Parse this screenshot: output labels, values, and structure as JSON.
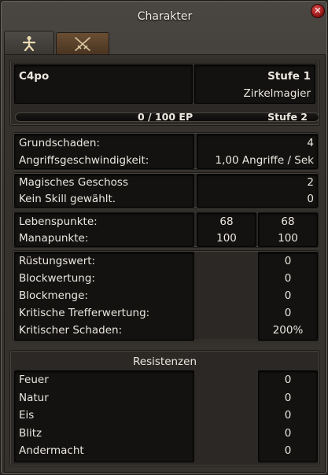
{
  "window": {
    "title": "Charakter"
  },
  "tabs": [
    {
      "name": "character",
      "icon": "person-icon",
      "active": true
    },
    {
      "name": "skills",
      "icon": "crossed-swords-icon",
      "active": false
    }
  ],
  "header": {
    "name": "C4po",
    "level_label": "Stufe 1",
    "class_name": "Zirkelmagier",
    "xp_text": "0 / 100 EP",
    "next_level": "Stufe 2",
    "xp_progress": 0
  },
  "damage": {
    "base_damage_label": "Grundschaden:",
    "base_damage_value": "4",
    "attack_speed_label": "Angriffsgeschwindigkeit:",
    "attack_speed_value": "1,00 Angriffe / Sek"
  },
  "skill": {
    "projectile_label": "Magisches Geschoss",
    "projectile_value": "2",
    "no_skill_label": "Kein Skill gewählt.",
    "no_skill_value": "0"
  },
  "vitals": {
    "hp_label": "Lebenspunkte:",
    "hp_current": "68",
    "hp_max": "68",
    "mana_label": "Manapunkte:",
    "mana_current": "100",
    "mana_max": "100"
  },
  "defense": {
    "rows": [
      {
        "label": "Rüstungswert:",
        "value": "0"
      },
      {
        "label": "Blockwertung:",
        "value": "0"
      },
      {
        "label": "Blockmenge:",
        "value": "0"
      },
      {
        "label": "Kritische Trefferwertung:",
        "value": "0"
      },
      {
        "label": "Kritischer Schaden:",
        "value": "200%"
      }
    ]
  },
  "resistances": {
    "title": "Resistenzen",
    "rows": [
      {
        "label": "Feuer",
        "value": "0"
      },
      {
        "label": "Natur",
        "value": "0"
      },
      {
        "label": "Eis",
        "value": "0"
      },
      {
        "label": "Blitz",
        "value": "0"
      },
      {
        "label": "Andermacht",
        "value": "0"
      }
    ]
  }
}
